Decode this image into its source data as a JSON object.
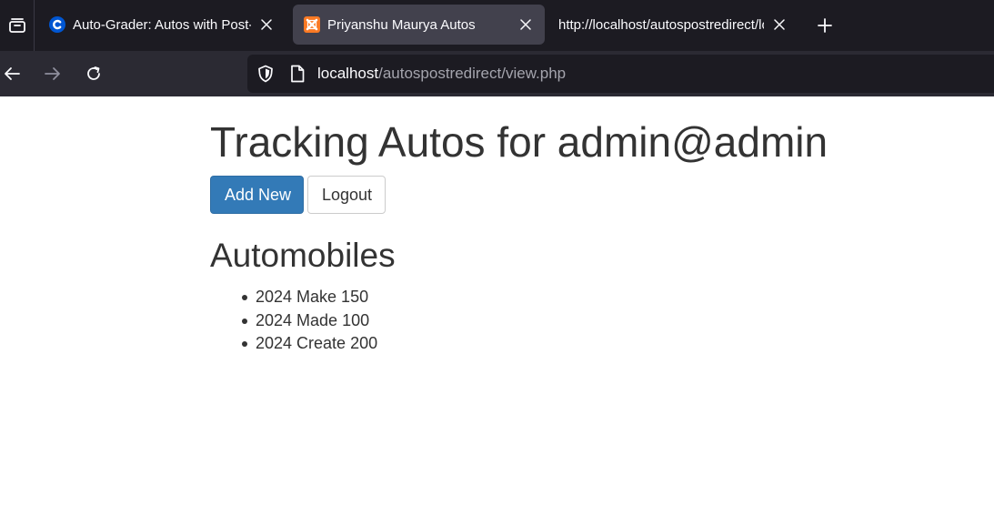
{
  "browser": {
    "tabs": [
      {
        "title": "Auto-Grader: Autos with Post-Redirect",
        "favicon": "coursera-c-icon",
        "active": false
      },
      {
        "title": "Priyanshu Maurya Autos",
        "favicon": "xampp-icon",
        "active": true
      },
      {
        "title": "http://localhost/autospostredirect/login.php",
        "favicon": "",
        "active": false
      }
    ],
    "url_host": "localhost",
    "url_path": "/autospostredirect/view.php",
    "colors": {
      "tabstrip": "#1c1b22",
      "toolbar": "#2b2a33",
      "active_tab": "#42414d"
    }
  },
  "page": {
    "title": "Tracking Autos for admin@admin",
    "buttons": {
      "add_new": "Add New",
      "logout": "Logout"
    },
    "section_title": "Automobiles",
    "autos": [
      "2024 Make 150",
      "2024 Made 100",
      "2024 Create 200"
    ],
    "colors": {
      "primary_button": "#337ab7",
      "text": "#333333"
    }
  }
}
